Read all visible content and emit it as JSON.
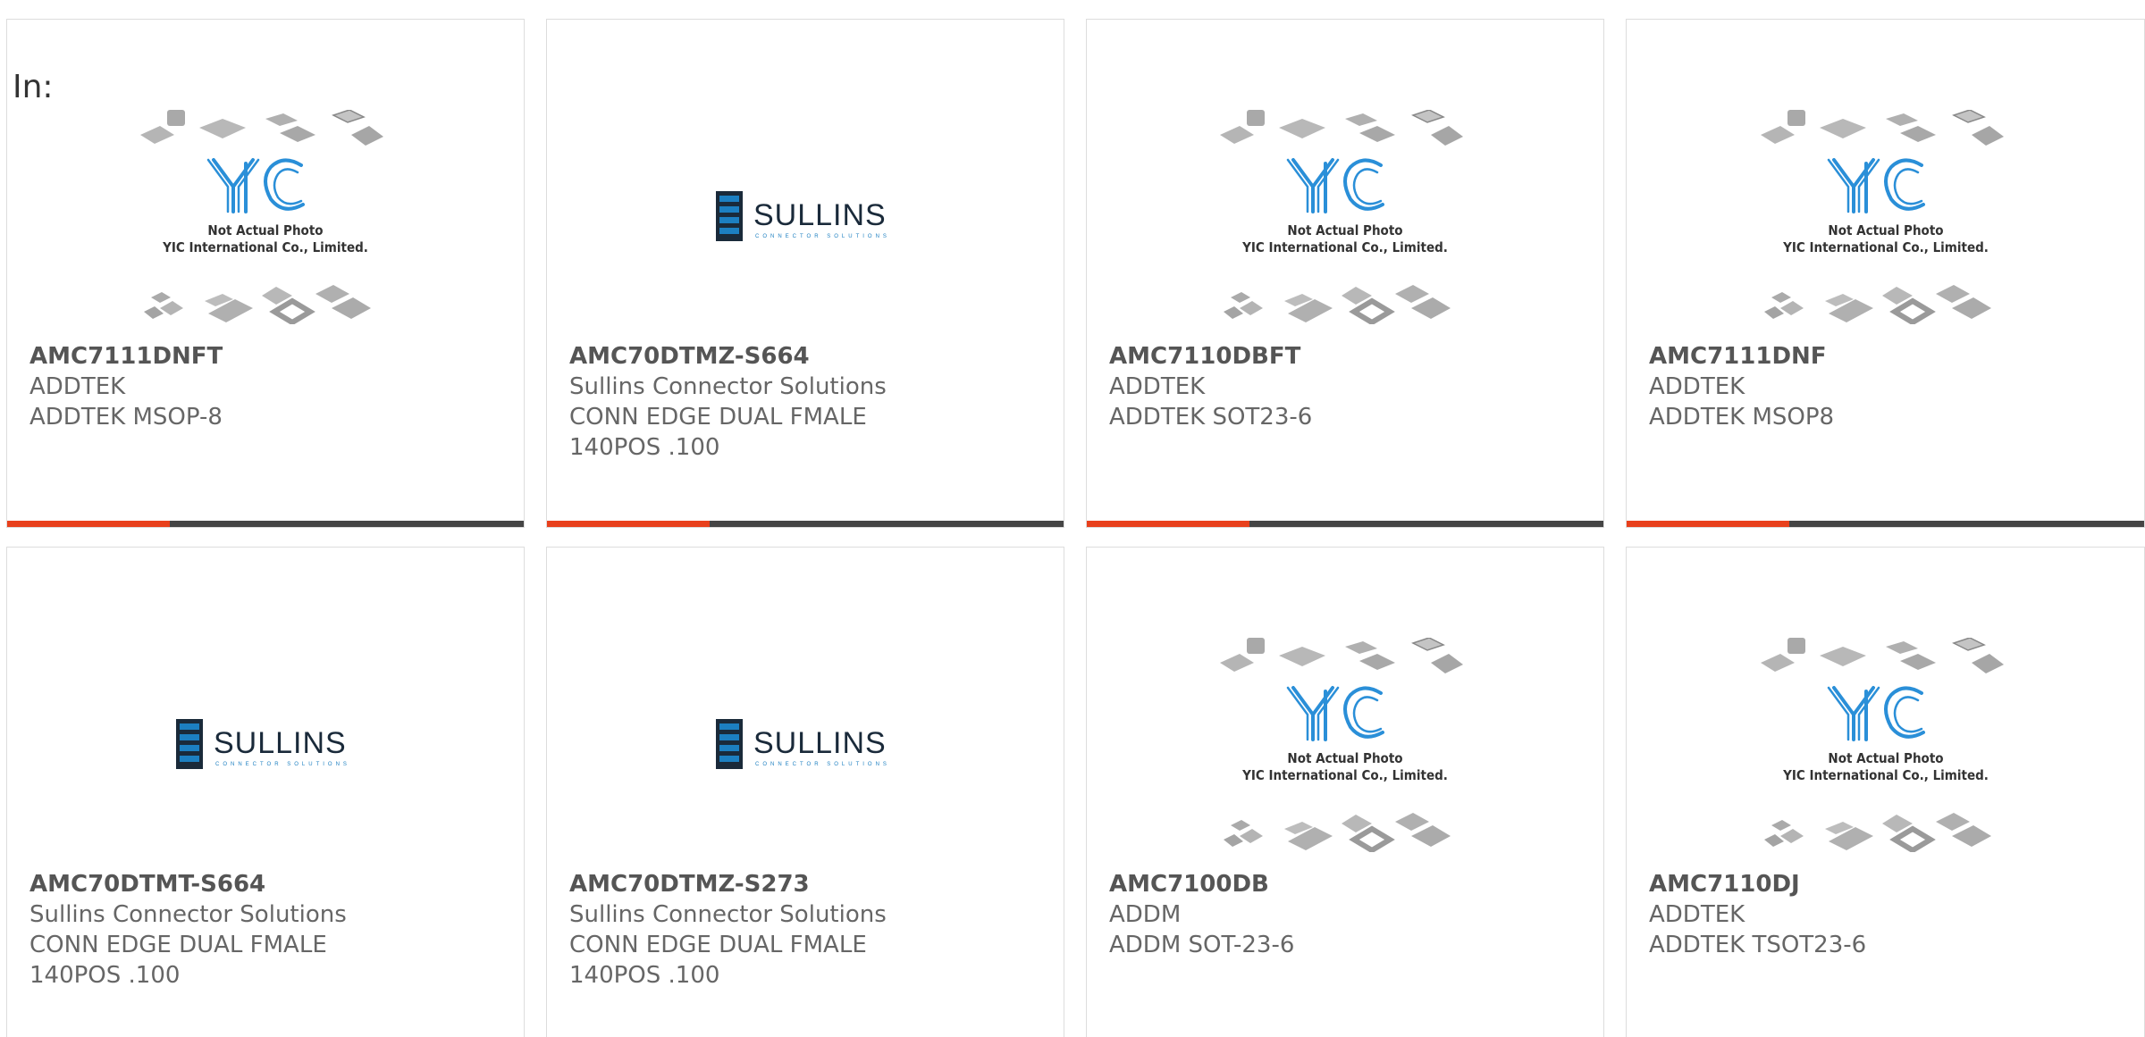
{
  "prefix_label": "In:",
  "colors": {
    "accent": "#e8401c",
    "bar": "#454545",
    "sullins_blue": "#1c7fc1",
    "yic_blue": "#2a8fd8",
    "chip_gray": "#b8b8b8"
  },
  "products": [
    {
      "part": "AMC7111DNFT",
      "mfr": "ADDTEK",
      "desc": "ADDTEK MSOP-8",
      "image": "yic-placeholder",
      "yic": {
        "line1": "Not Actual Photo",
        "line2": "YIC International Co., Limited."
      }
    },
    {
      "part": "AMC70DTMZ-S664",
      "mfr": "Sullins Connector Solutions",
      "desc": "CONN EDGE DUAL FMALE 140POS .100",
      "image": "sullins-logo",
      "logo": {
        "name": "SULLINS",
        "tagline": "CONNECTOR SOLUTIONS"
      }
    },
    {
      "part": "AMC7110DBFT",
      "mfr": "ADDTEK",
      "desc": "ADDTEK SOT23-6",
      "image": "yic-placeholder",
      "yic": {
        "line1": "Not Actual Photo",
        "line2": "YIC International Co., Limited."
      }
    },
    {
      "part": "AMC7111DNF",
      "mfr": "ADDTEK",
      "desc": "ADDTEK MSOP8",
      "image": "yic-placeholder",
      "yic": {
        "line1": "Not Actual Photo",
        "line2": "YIC International Co., Limited."
      }
    },
    {
      "part": "AMC70DTMT-S664",
      "mfr": "Sullins Connector Solutions",
      "desc": "CONN EDGE DUAL FMALE 140POS .100",
      "image": "sullins-logo",
      "logo": {
        "name": "SULLINS",
        "tagline": "CONNECTOR SOLUTIONS"
      }
    },
    {
      "part": "AMC70DTMZ-S273",
      "mfr": "Sullins Connector Solutions",
      "desc": "CONN EDGE DUAL FMALE 140POS .100",
      "image": "sullins-logo",
      "logo": {
        "name": "SULLINS",
        "tagline": "CONNECTOR SOLUTIONS"
      }
    },
    {
      "part": "AMC7100DB",
      "mfr": "ADDM",
      "desc": "ADDM SOT-23-6",
      "image": "yic-placeholder",
      "yic": {
        "line1": "Not Actual Photo",
        "line2": "YIC International Co., Limited."
      }
    },
    {
      "part": "AMC7110DJ",
      "mfr": "ADDTEK",
      "desc": "ADDTEK TSOT23-6",
      "image": "yic-placeholder",
      "yic": {
        "line1": "Not Actual Photo",
        "line2": "YIC International Co., Limited."
      }
    }
  ]
}
